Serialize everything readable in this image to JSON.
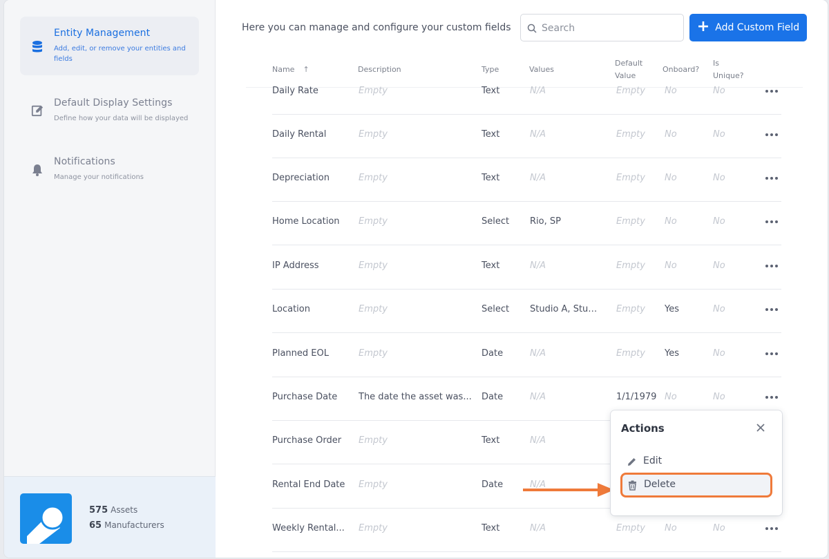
{
  "sidebar": {
    "items": [
      {
        "title": "Entity Management",
        "subtitle": "Add, edit, or remove your entities and fields",
        "icon": "database-icon",
        "active": true
      },
      {
        "title": "Default Display Settings",
        "subtitle": "Define how your data will be displayed",
        "icon": "edit-square-icon",
        "active": false
      },
      {
        "title": "Notifications",
        "subtitle": "Manage your notifications",
        "icon": "bell-icon",
        "active": false
      }
    ],
    "stats": {
      "assets_count": "575",
      "assets_label": "Assets",
      "manufacturers_count": "65",
      "manufacturers_label": "Manufacturers"
    }
  },
  "header": {
    "intro": "Here you can manage and configure your custom fields",
    "search_placeholder": "Search",
    "add_button": "Add Custom Field"
  },
  "table": {
    "columns": {
      "name": "Name",
      "description": "Description",
      "type": "Type",
      "values": "Values",
      "default_1": "Default",
      "default_2": "Value",
      "onboard": "Onboard?",
      "unique_1": "Is",
      "unique_2": "Unique?"
    },
    "rows": [
      {
        "name": "Daily Rate",
        "description": "Empty",
        "type": "Text",
        "values": "N/A",
        "default": "Empty",
        "onboard": "No",
        "unique": "No"
      },
      {
        "name": "Daily Rental",
        "description": "Empty",
        "type": "Text",
        "values": "N/A",
        "default": "Empty",
        "onboard": "No",
        "unique": "No"
      },
      {
        "name": "Depreciation",
        "description": "Empty",
        "type": "Text",
        "values": "N/A",
        "default": "Empty",
        "onboard": "No",
        "unique": "No"
      },
      {
        "name": "Home Location",
        "description": "Empty",
        "type": "Select",
        "values": "Rio, SP",
        "default": "Empty",
        "onboard": "No",
        "unique": "No"
      },
      {
        "name": "IP Address",
        "description": "Empty",
        "type": "Text",
        "values": "N/A",
        "default": "Empty",
        "onboard": "No",
        "unique": "No"
      },
      {
        "name": "Location",
        "description": "Empty",
        "type": "Select",
        "values": "Studio A, Studi...",
        "default": "Empty",
        "onboard": "Yes",
        "unique": "No"
      },
      {
        "name": "Planned EOL",
        "description": "Empty",
        "type": "Date",
        "values": "N/A",
        "default": "Empty",
        "onboard": "Yes",
        "unique": "No"
      },
      {
        "name": "Purchase Date",
        "description": "The date the asset was...",
        "type": "Date",
        "values": "N/A",
        "default": "1/1/1979",
        "onboard": "No",
        "unique": "No"
      },
      {
        "name": "Purchase Order",
        "description": "Empty",
        "type": "Text",
        "values": "N/A",
        "default": "",
        "onboard": "",
        "unique": ""
      },
      {
        "name": "Rental End Date",
        "description": "Empty",
        "type": "Date",
        "values": "N/A",
        "default": "",
        "onboard": "",
        "unique": ""
      },
      {
        "name": "Weekly Rental...",
        "description": "Empty",
        "type": "Text",
        "values": "N/A",
        "default": "Empty",
        "onboard": "No",
        "unique": "No"
      }
    ]
  },
  "actions_popover": {
    "title": "Actions",
    "items": [
      {
        "label": "Edit",
        "icon": "pencil-icon"
      },
      {
        "label": "Delete",
        "icon": "trash-icon"
      }
    ]
  },
  "colors": {
    "accent": "#1a73e8",
    "highlight": "#ef7a3a",
    "logo": "#1a8de8"
  }
}
